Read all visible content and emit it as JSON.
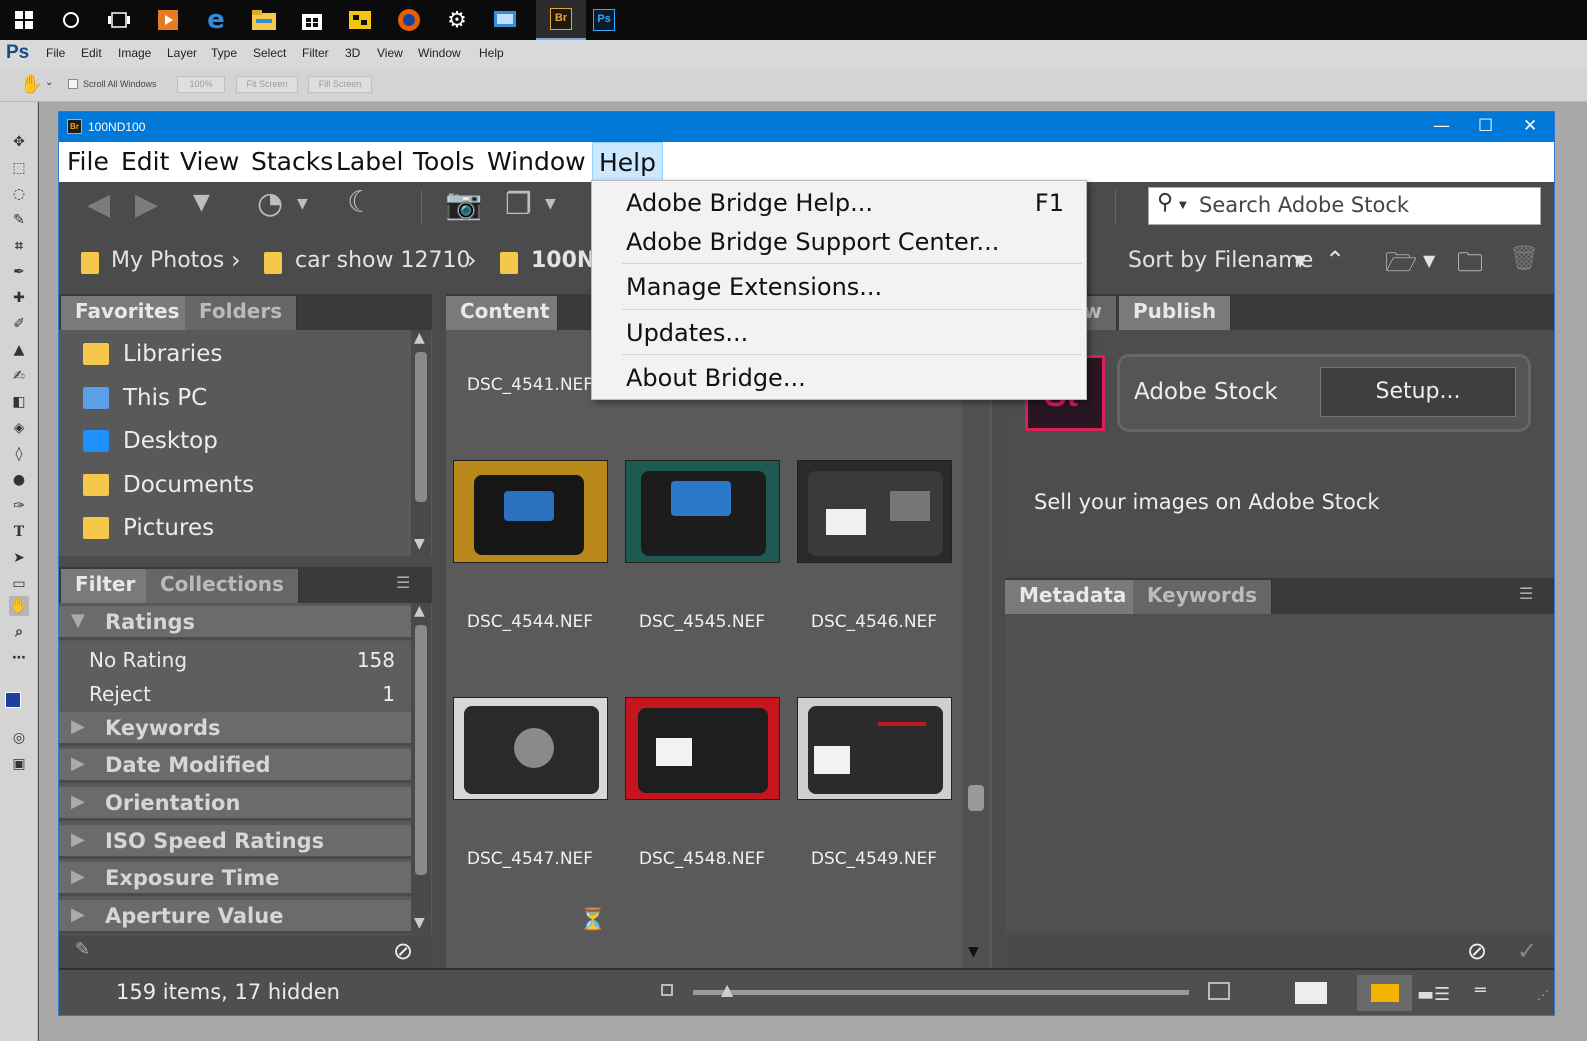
{
  "taskbar": {
    "icons": [
      "windows-icon",
      "cortana-icon",
      "task-view-icon",
      "media-icon",
      "edge-icon",
      "file-explorer-icon",
      "store-icon",
      "app-icon",
      "firefox-icon",
      "settings-icon",
      "network-icon",
      "bridge-icon",
      "photoshop-icon"
    ],
    "bridge_label": "Br",
    "photoshop_label": "Ps"
  },
  "photoshop": {
    "logo": "Ps",
    "menu": [
      "File",
      "Edit",
      "Image",
      "Layer",
      "Type",
      "Select",
      "Filter",
      "3D",
      "View",
      "Window",
      "Help"
    ],
    "options": {
      "scroll_all_windows": "Scroll All Windows",
      "zoom_100": "100%",
      "fit_screen": "Fit Screen",
      "fill_screen": "Fill Screen"
    }
  },
  "bridge": {
    "title": "100ND100",
    "app_badge": "Br",
    "window_controls": {
      "minimize": "—",
      "maximize": "☐",
      "close": "✕"
    },
    "menu": [
      "File",
      "Edit",
      "View",
      "Stacks",
      "Label",
      "Tools",
      "Window",
      "Help"
    ],
    "open_menu": "Help",
    "search_placeholder": "Search Adobe Stock",
    "breadcrumb": [
      "My Photos",
      "car show 12710",
      "100N"
    ],
    "sort_label": "Sort by Filename",
    "favorites_tabs": [
      "Favorites",
      "Folders"
    ],
    "favorites": [
      {
        "label": "Libraries",
        "icon": "libraries-icon",
        "color": "#f5c84c"
      },
      {
        "label": "This PC",
        "icon": "computer-icon",
        "color": "#5aa0e6"
      },
      {
        "label": "Desktop",
        "icon": "desktop-icon",
        "color": "#1e90ff"
      },
      {
        "label": "Documents",
        "icon": "documents-icon",
        "color": "#f5c84c"
      },
      {
        "label": "Pictures",
        "icon": "pictures-icon",
        "color": "#f5c84c"
      }
    ],
    "filter_tabs": [
      "Filter",
      "Collections"
    ],
    "filter": {
      "ratings_header": "Ratings",
      "ratings": [
        {
          "label": "No Rating",
          "count": "158"
        },
        {
          "label": "Reject",
          "count": "1"
        }
      ],
      "sections": [
        "Keywords",
        "Date Modified",
        "Orientation",
        "ISO Speed Ratings",
        "Exposure Time",
        "Aperture Value"
      ]
    },
    "content_tab": "Content",
    "files": [
      {
        "name": "DSC_4541.NEF"
      },
      {
        "name": "DSC_4544.NEF",
        "tone": "#b8891a"
      },
      {
        "name": "DSC_4545.NEF",
        "tone": "#1f5a52"
      },
      {
        "name": "DSC_4546.NEF",
        "tone": "#2a2a2a"
      },
      {
        "name": "DSC_4547.NEF",
        "tone": "#d7d7d7"
      },
      {
        "name": "DSC_4548.NEF",
        "tone": "#c4161c"
      },
      {
        "name": "DSC_4549.NEF",
        "tone": "#cfcfcf"
      }
    ],
    "publish": {
      "tabs": [
        "w",
        "Publish"
      ],
      "stock_logo": "St",
      "service": "Adobe Stock",
      "setup_button": "Setup...",
      "tagline": "Sell your images on Adobe Stock"
    },
    "metadata_tabs": [
      "Metadata",
      "Keywords"
    ],
    "status": "159 items, 17 hidden"
  },
  "help_menu": [
    {
      "label": "Adobe Bridge Help...",
      "shortcut": "F1"
    },
    {
      "label": "Adobe Bridge Support Center...",
      "shortcut": ""
    },
    {
      "label": "Manage Extensions...",
      "shortcut": ""
    },
    {
      "label": "Updates...",
      "shortcut": ""
    },
    {
      "label": "About Bridge...",
      "shortcut": ""
    }
  ],
  "colors": {
    "bridge_title_bar": "#0078d7",
    "bridge_accent": "#e8a33d",
    "stock_logo": "#da1f59"
  }
}
